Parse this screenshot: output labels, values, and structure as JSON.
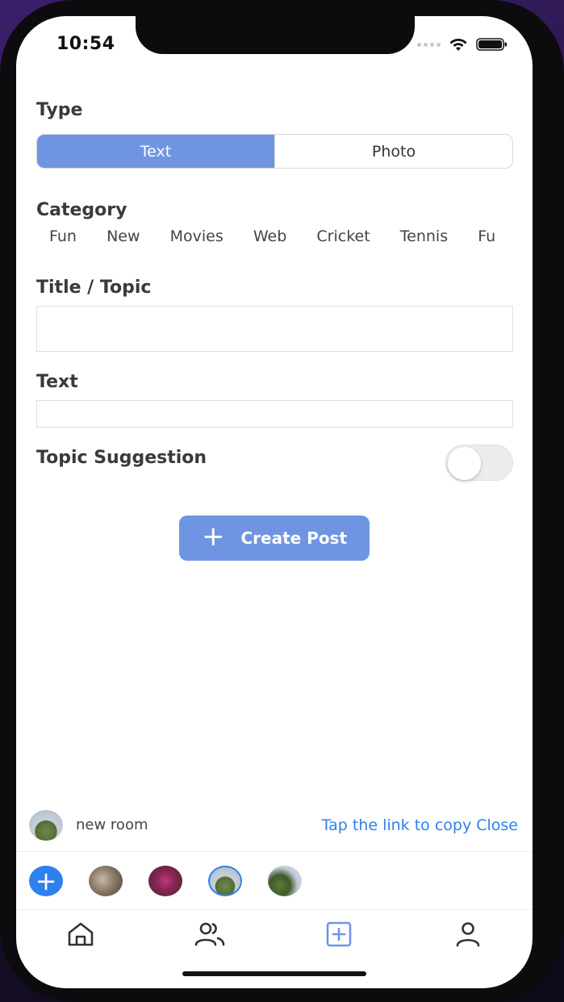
{
  "status_bar": {
    "time": "10:54"
  },
  "form": {
    "type_label": "Type",
    "type_options": [
      "Text",
      "Photo"
    ],
    "type_selected": "Text",
    "category_label": "Category",
    "categories": [
      "Fun",
      "New",
      "Movies",
      "Web",
      "Cricket",
      "Tennis",
      "Fu"
    ],
    "title_label": "Title / Topic",
    "title_value": "",
    "text_label": "Text",
    "text_value": "",
    "topic_suggestion_label": "Topic Suggestion",
    "topic_suggestion_on": false,
    "create_button_label": "Create Post",
    "create_button_icon": "+"
  },
  "room": {
    "name": "new room",
    "link_text": "Tap the link to copy Close"
  },
  "stories": {
    "add_icon": "+"
  },
  "tabs": [
    "home-icon",
    "people-icon",
    "add-post-icon",
    "profile-icon"
  ],
  "colors": {
    "accent": "#6f95e2",
    "link": "#2f80ed"
  }
}
